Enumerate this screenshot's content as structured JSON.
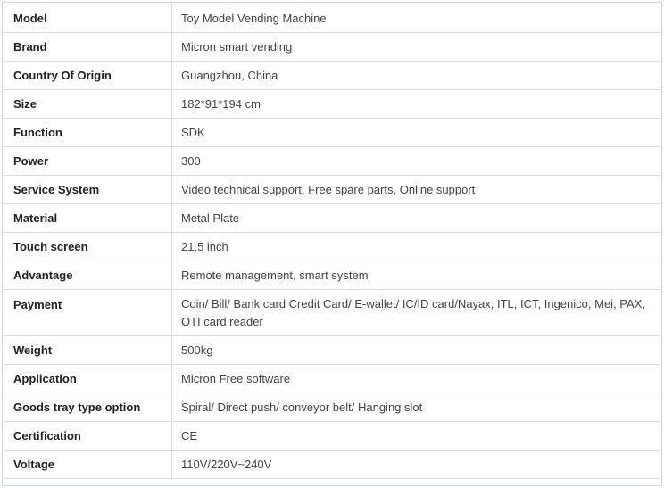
{
  "specs": [
    {
      "key": "Model",
      "value": "Toy Model Vending Machine"
    },
    {
      "key": "Brand",
      "value": "Micron smart vending"
    },
    {
      "key": "Country Of Origin",
      "value": "Guangzhou, China"
    },
    {
      "key": "Size",
      "value": "182*91*194 cm"
    },
    {
      "key": "Function",
      "value": "SDK"
    },
    {
      "key": "Power",
      "value": "300"
    },
    {
      "key": "Service System",
      "value": "Video technical support, Free spare parts, Online support"
    },
    {
      "key": "Material",
      "value": "Metal Plate"
    },
    {
      "key": "Touch screen",
      "value": "21.5 inch"
    },
    {
      "key": "Advantage",
      "value": "Remote management, smart system"
    },
    {
      "key": "Payment",
      "value": "Coin/ Bill/ Bank card Credit Card/ E-wallet/ IC/ID card/Nayax, ITL, ICT, Ingenico, Mei, PAX, OTI card reader"
    },
    {
      "key": "Weight",
      "value": "500kg"
    },
    {
      "key": "Application",
      "value": "Micron Free software"
    },
    {
      "key": "Goods tray type option",
      "value": "Spiral/ Direct push/ conveyor belt/ Hanging slot"
    },
    {
      "key": "Certification",
      "value": "CE"
    },
    {
      "key": "Voltage",
      "value": "110V/220V~240V"
    }
  ]
}
